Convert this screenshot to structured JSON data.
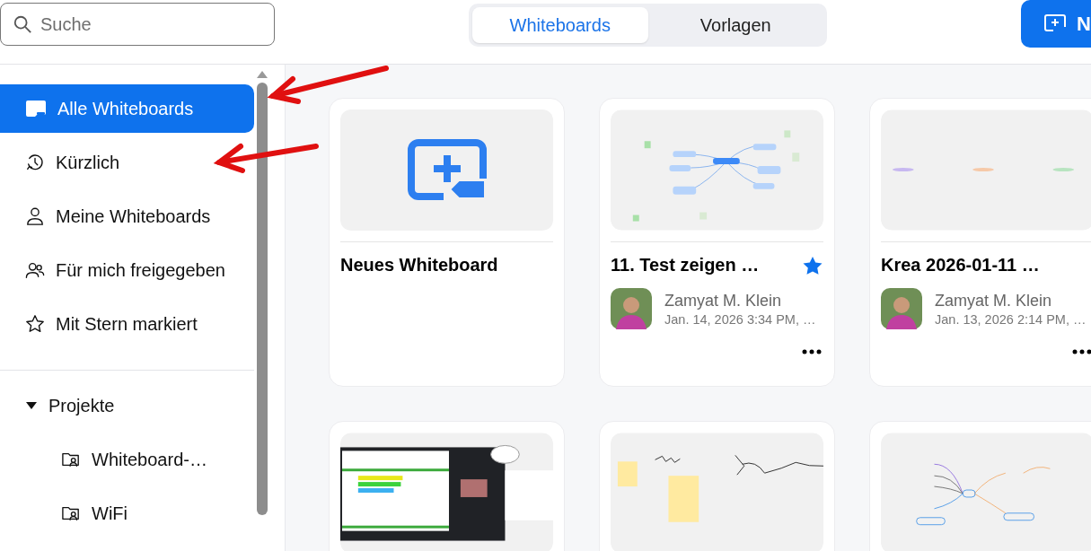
{
  "search": {
    "placeholder": "Suche"
  },
  "tabs": [
    {
      "label": "Whiteboards",
      "selected": true
    },
    {
      "label": "Vorlagen",
      "selected": false
    }
  ],
  "new_button": {
    "label": "N"
  },
  "sidebar": {
    "items": [
      {
        "label": "Alle Whiteboards",
        "selected": true
      },
      {
        "label": "Kürzlich",
        "selected": false
      },
      {
        "label": "Meine Whiteboards",
        "selected": false
      },
      {
        "label": "Für mich freigegeben",
        "selected": false
      },
      {
        "label": "Mit Stern markiert",
        "selected": false
      }
    ],
    "projects": {
      "label": "Projekte",
      "expanded": true,
      "children": [
        {
          "label": "Whiteboard-…"
        },
        {
          "label": "WiFi"
        }
      ]
    }
  },
  "cards": [
    {
      "kind": "new",
      "title": "Neues Whiteboard"
    },
    {
      "kind": "board",
      "title": "11. Test zeigen …",
      "starred": true,
      "author": "Zamyat M. Klein",
      "date": "Jan. 14, 2026 3:34 PM, …"
    },
    {
      "kind": "board",
      "title": "Krea 2026-01-11 …",
      "starred": false,
      "author": "Zamyat M. Klein",
      "date": "Jan. 13, 2026 2:14 PM, …"
    },
    {
      "kind": "board"
    },
    {
      "kind": "board"
    },
    {
      "kind": "board"
    }
  ]
}
